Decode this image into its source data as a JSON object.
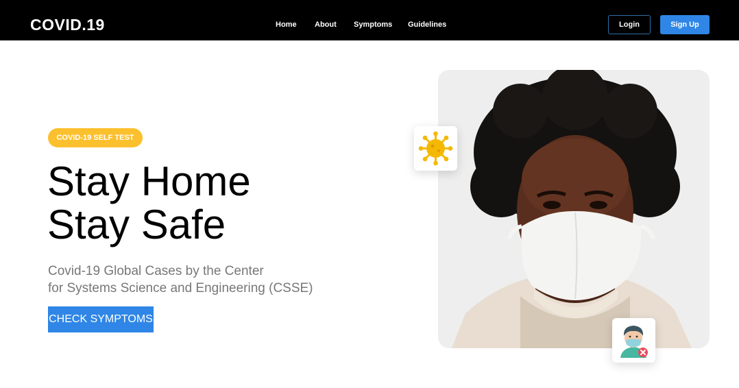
{
  "header": {
    "logo": "COVID.19",
    "nav": [
      "Home",
      "About",
      "Symptoms",
      "Guidelines"
    ],
    "login_label": "Login",
    "signup_label": "Sign Up"
  },
  "hero": {
    "badge": "COVID-19 SELF TEST",
    "headline_line1": "Stay Home",
    "headline_line2": "Stay Safe",
    "subtitle_line1": "Covid-19 Global Cases by the Center",
    "subtitle_line2": "for Systems Science and Engineering (CSSE)",
    "cta_label": "CHECK SYMPTOMS"
  },
  "icons": {
    "virus": "virus-icon",
    "masked_person": "masked-person-icon"
  },
  "colors": {
    "topbar": "#000000",
    "accent_blue": "#2f86e6",
    "badge_yellow": "#fbc02d",
    "subtitle_gray": "#777777"
  }
}
